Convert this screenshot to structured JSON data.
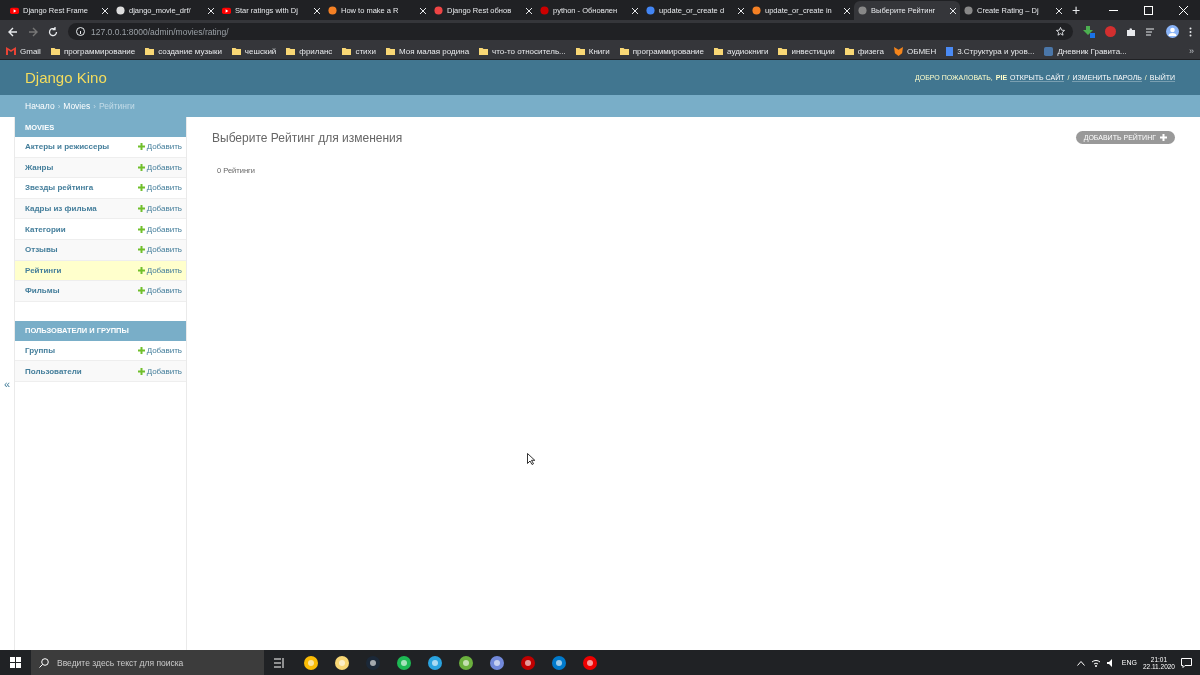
{
  "browser": {
    "tabs": [
      {
        "title": "Django Rest Frame",
        "selected": false
      },
      {
        "title": "django_movie_drf/",
        "selected": false
      },
      {
        "title": "Star ratings with Dj",
        "selected": false
      },
      {
        "title": "How to make a R",
        "selected": false
      },
      {
        "title": "Django Rest обнов",
        "selected": false
      },
      {
        "title": "python - Обновлен",
        "selected": false
      },
      {
        "title": "update_or_create d",
        "selected": false
      },
      {
        "title": "update_or_create in",
        "selected": false
      },
      {
        "title": "Выберите Рейтинг",
        "selected": true
      },
      {
        "title": "Create Rating – Dj",
        "selected": false
      }
    ],
    "new_tab": "+",
    "url": "127.0.0.1:8000/admin/movies/rating/",
    "bookmarks": [
      "Gmail",
      "программирование",
      "создание музыки",
      "чешский",
      "фриланс",
      "стихи",
      "Моя малая родина",
      "что-то относитель...",
      "Книги",
      "программирование",
      "аудиокниги",
      "инвестиции",
      "физега",
      "ОБМЕН",
      "3.Структура и уров...",
      "Дневник Гравита..."
    ],
    "more": "»"
  },
  "site": {
    "brand": "Django Kino",
    "welcome": "ДОБРО ПОЖАЛОВАТЬ,",
    "user": "PIE",
    "links": [
      "ОТКРЫТЬ САЙТ",
      "ИЗМЕНИТЬ ПАРОЛЬ",
      "ВЫЙТИ"
    ],
    "link_separator": "/",
    "crumb_separator": "›",
    "breadcrumbs": [
      {
        "label": "Начало",
        "current": false
      },
      {
        "label": "Movies",
        "current": false
      },
      {
        "label": "Рейтинги",
        "current": true
      }
    ]
  },
  "sidebar": {
    "modules": [
      {
        "title": "MOVIES",
        "models": [
          {
            "name": "Актеры и режиссеры",
            "add": "Добавить",
            "selected": false
          },
          {
            "name": "Жанры",
            "add": "Добавить",
            "selected": false
          },
          {
            "name": "Звезды рейтинга",
            "add": "Добавить",
            "selected": false
          },
          {
            "name": "Кадры из фильма",
            "add": "Добавить",
            "selected": false
          },
          {
            "name": "Категории",
            "add": "Добавить",
            "selected": false
          },
          {
            "name": "Отзывы",
            "add": "Добавить",
            "selected": false
          },
          {
            "name": "Рейтинги",
            "add": "Добавить",
            "selected": true
          },
          {
            "name": "Фильмы",
            "add": "Добавить",
            "selected": false
          }
        ]
      },
      {
        "title": "ПОЛЬЗОВАТЕЛИ И ГРУППЫ",
        "models": [
          {
            "name": "Группы",
            "add": "Добавить",
            "selected": false
          },
          {
            "name": "Пользователи",
            "add": "Добавить",
            "selected": false
          }
        ]
      }
    ],
    "collapse": "«"
  },
  "content": {
    "title": "Выберите Рейтинг для изменения",
    "add_button": "ДОБАВИТЬ РЕЙТИНГ",
    "count": "0 Рейтинги"
  },
  "taskbar": {
    "search_placeholder": "Введите здесь текст для поиска",
    "lang": "ENG",
    "time": "21:01",
    "date": "22.11.2020"
  }
}
